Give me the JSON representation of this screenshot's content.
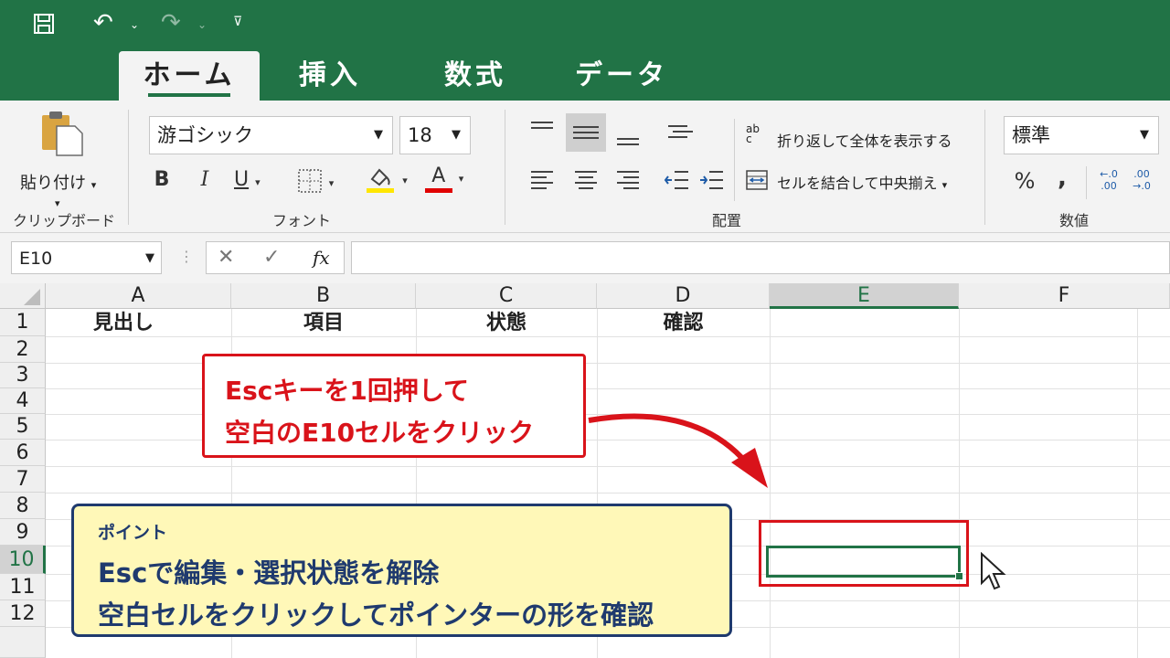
{
  "tabs": [
    {
      "label": "ホーム",
      "active": true
    },
    {
      "label": "挿入",
      "active": false
    },
    {
      "label": "数式",
      "active": false
    },
    {
      "label": "データ",
      "active": false
    }
  ],
  "clipboard": {
    "paste_label": "貼り付け",
    "group_label": "クリップボード"
  },
  "font": {
    "name": "游ゴシック",
    "size": "18",
    "bold": "B",
    "italic": "I",
    "underline": "U",
    "color_letter": "A",
    "group_label": "フォント"
  },
  "alignment": {
    "wrap_label": "折り返して全体を表示する",
    "merge_label": "セルを結合して中央揃え",
    "group_label": "配置",
    "wrap_icon_text": "ab c"
  },
  "number": {
    "format": "標準",
    "percent": "%",
    "comma": ",",
    "inc_decimal": "←.0 .00",
    "dec_decimal": ".00 →.0",
    "group_label": "数値"
  },
  "formula_bar": {
    "name_box": "E10",
    "fx": "fx",
    "value": ""
  },
  "columns": [
    "A",
    "B",
    "C",
    "D",
    "E",
    "F"
  ],
  "rows": [
    "1",
    "2",
    "3",
    "4",
    "5",
    "6",
    "7",
    "8",
    "9",
    "10",
    "11",
    "12"
  ],
  "row1_cells": [
    "見出し",
    "項目",
    "状態",
    "確認"
  ],
  "selected_cell": "E10",
  "callout_red": {
    "line1": "Escキーを1回押して",
    "line2": "空白のE10セルをクリック"
  },
  "callout_point": {
    "head": "ポイント",
    "line1": "Escで編集・選択状態を解除",
    "line2": "空白セルをクリックしてポインターの形を確認"
  },
  "colors": {
    "excel_green": "#217346",
    "red": "#d9131a",
    "navy": "#1f3a6e",
    "yellow_bg": "#fff8b8"
  }
}
